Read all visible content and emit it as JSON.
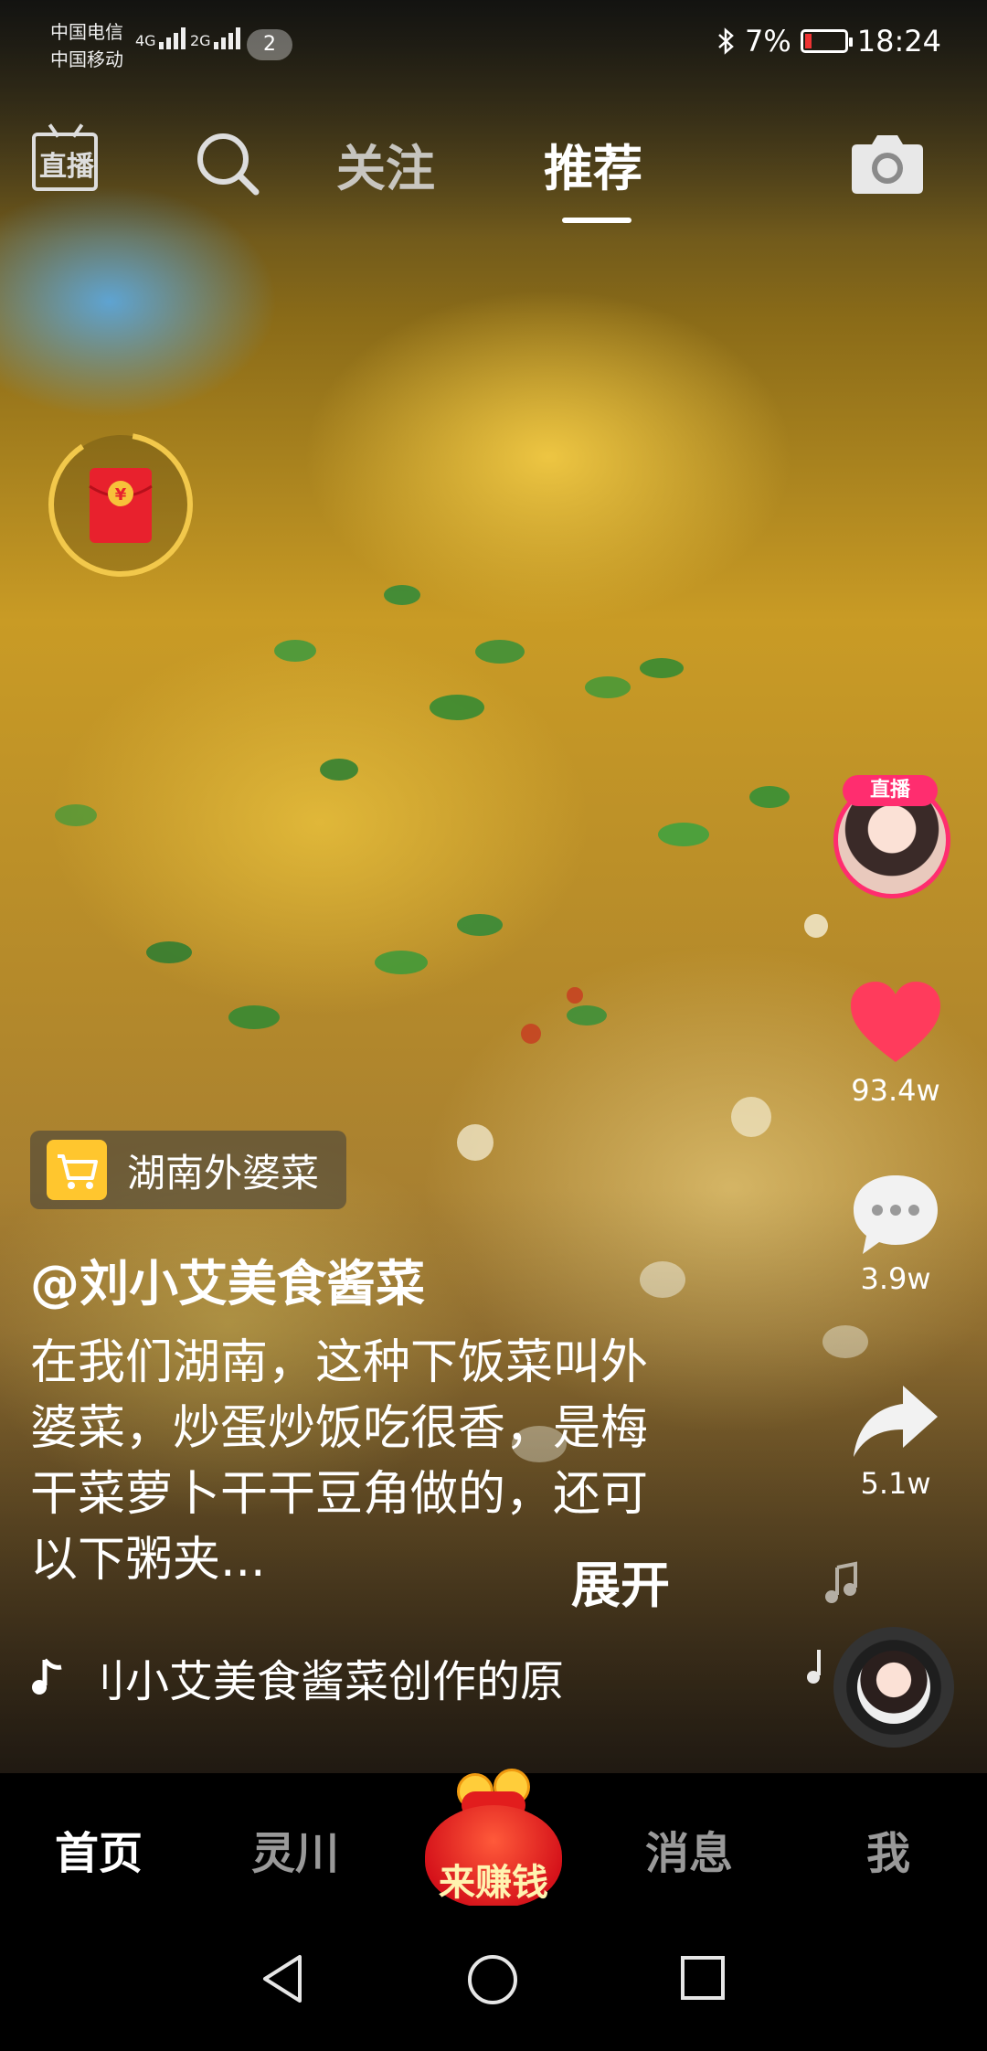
{
  "status_bar": {
    "carrier_1": "中国电信",
    "carrier_2": "中国移动",
    "net_1": "4G",
    "net_2": "2G",
    "notification_count": "2",
    "battery_percent": "7%",
    "time": "18:24"
  },
  "top_nav": {
    "live_label": "直播",
    "tab_follow": "关注",
    "tab_recommend": "推荐",
    "active_tab": "推荐"
  },
  "right_rail": {
    "live_badge": "直播",
    "likes": "93.4w",
    "comments": "3.9w",
    "shares": "5.1w"
  },
  "caption": {
    "shop_tag": "湖南外婆菜",
    "username": "@刘小艾美食酱菜",
    "description": "在我们湖南，这种下饭菜叫外婆菜，炒蛋炒饭吃很香，是梅干菜萝卜干干豆角做的，还可以下粥夹...",
    "expand_label": "展开",
    "music_text": "刂小艾美食酱菜创作的原"
  },
  "bottom_tabs": {
    "home": "首页",
    "lingchuan": "灵川",
    "earn": "来赚钱",
    "messages": "消息",
    "me": "我"
  },
  "colors": {
    "like": "#ff3b5c",
    "live_ring": "#ff2d6f",
    "packet_ring": "#f2c84b",
    "cart": "#ffc62e"
  },
  "icons": [
    "live-icon",
    "search-icon",
    "camera-icon",
    "red-packet-icon",
    "heart-icon",
    "comment-icon",
    "share-icon",
    "cart-icon",
    "music-note-icon",
    "back-icon",
    "home-icon",
    "recents-icon"
  ]
}
